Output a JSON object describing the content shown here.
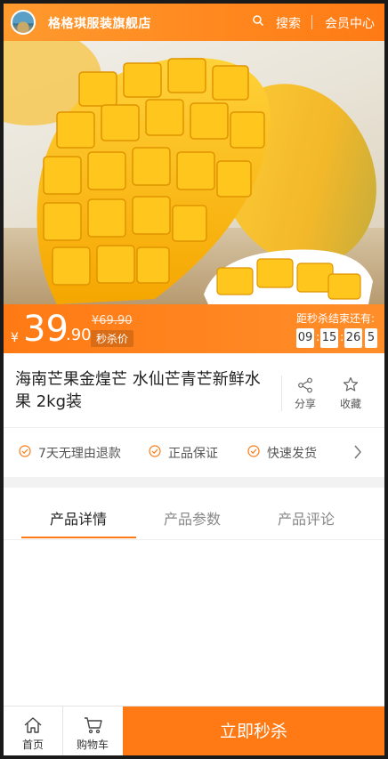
{
  "header": {
    "store_name": "格格琪服装旗舰店",
    "search_label": "搜索",
    "member_label": "会员中心",
    "accent": "#ff7a14"
  },
  "price": {
    "currency": "¥",
    "integer": "39",
    "decimal": ".90",
    "original": "¥69.90",
    "tag": "秒杀价",
    "countdown_label": "距秒杀结束还有:",
    "countdown": [
      "09",
      "15",
      "26",
      "5"
    ]
  },
  "product": {
    "title": "海南芒果金煌芒 水仙芒青芒新鲜水果 2kg装",
    "share_label": "分享",
    "favorite_label": "收藏"
  },
  "guarantees": [
    "7天无理由退款",
    "正品保证",
    "快速发货"
  ],
  "tabs": [
    {
      "label": "产品详情",
      "active": true
    },
    {
      "label": "产品参数",
      "active": false
    },
    {
      "label": "产品评论",
      "active": false
    }
  ],
  "bottom": {
    "home_label": "首页",
    "cart_label": "购物车",
    "buy_label": "立即秒杀"
  },
  "icons": [
    "store-logo",
    "search-icon",
    "share-icon",
    "star-icon",
    "check-circle-icon",
    "chevron-right-icon",
    "home-icon",
    "cart-icon"
  ]
}
